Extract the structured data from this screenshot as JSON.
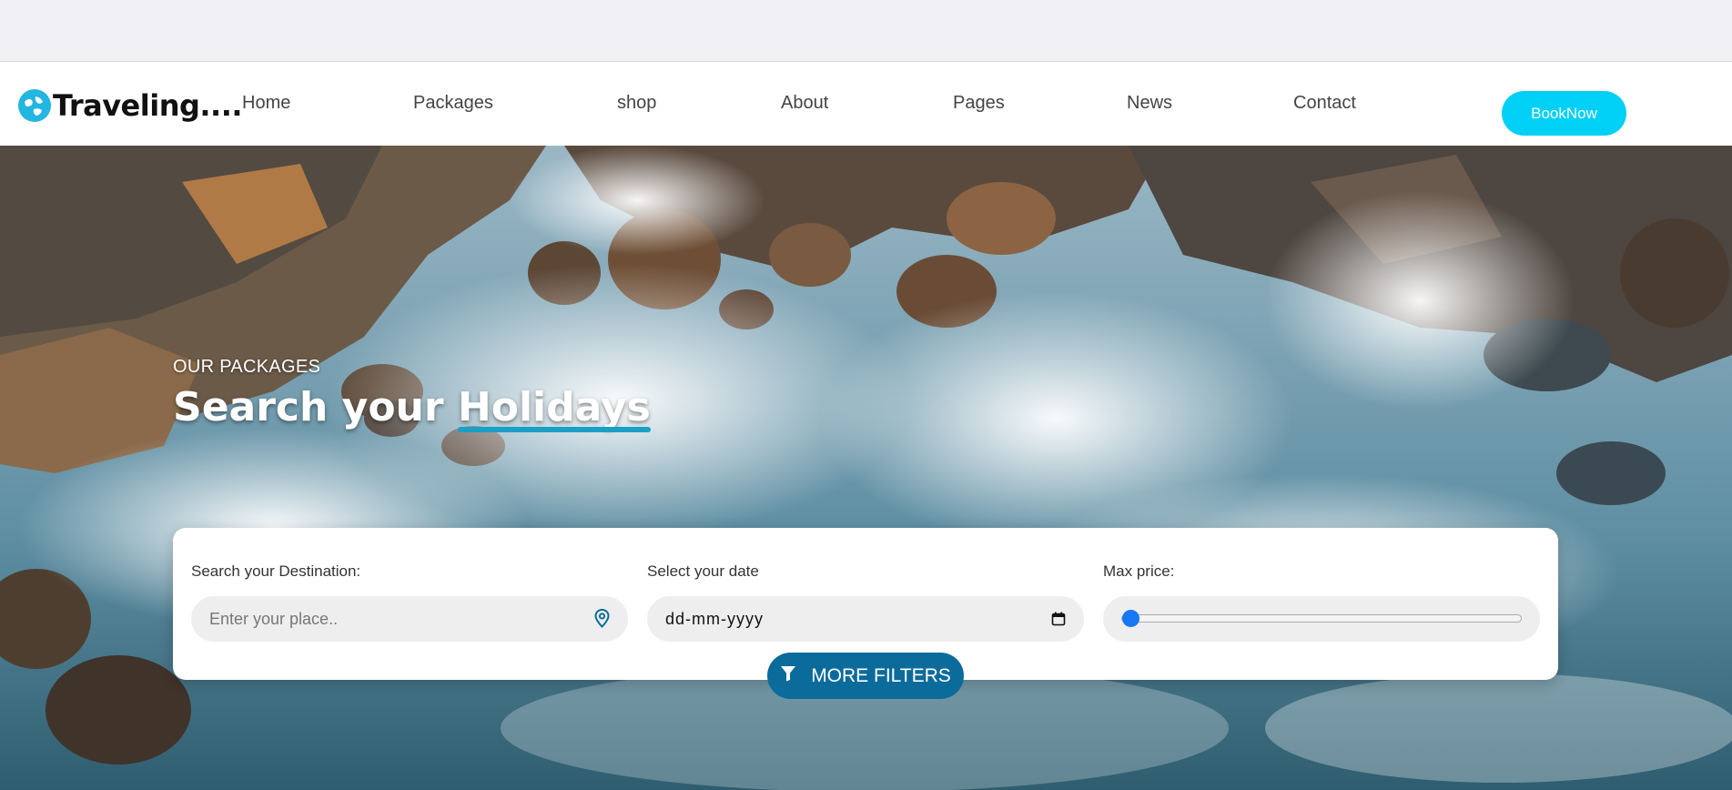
{
  "header": {
    "logo_text": "Traveling....",
    "logo_icon": "globe-icon"
  },
  "nav": {
    "items": [
      {
        "label": "Home"
      },
      {
        "label": "Packages"
      },
      {
        "label": "shop"
      },
      {
        "label": "About"
      },
      {
        "label": "Pages"
      },
      {
        "label": "News"
      },
      {
        "label": "Contact"
      }
    ],
    "book_label": "BookNow"
  },
  "hero": {
    "eyebrow": "OUR PACKAGES",
    "headline_prefix": "Search your ",
    "headline_highlight": "Holidays"
  },
  "search": {
    "destination_label": "Search your Destination:",
    "destination_placeholder": "Enter your place..",
    "date_label": "Select your date",
    "date_value": "dd-mm-yyyy",
    "price_label": "Max price:",
    "price_slider_level": 0,
    "more_filters_label": "MORE FILTERS"
  },
  "colors": {
    "accent": "#00d0f5",
    "primary": "#0b6b9b",
    "slider": "#1877f2"
  }
}
